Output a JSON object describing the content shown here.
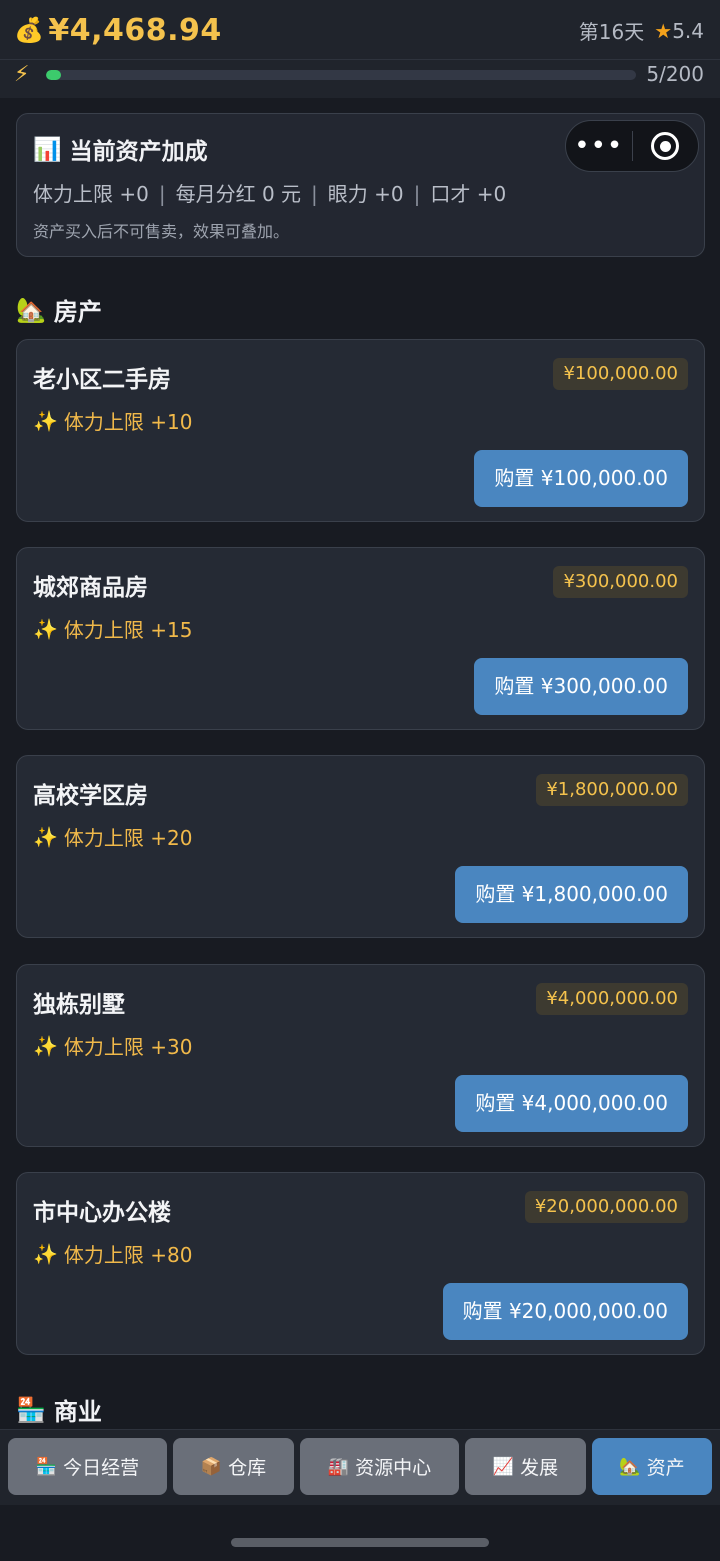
{
  "header": {
    "money_icon": "money-bag-icon",
    "money": "¥4,468.94",
    "day": "第16天",
    "star_icon": "star-icon",
    "rating": "5.4"
  },
  "energy": {
    "icon": "lightning-icon",
    "current": 5,
    "max": 200,
    "label": "5/200"
  },
  "bonus_panel": {
    "icon": "bar-chart-icon",
    "title": "当前资产加成",
    "stats": [
      "体力上限 +0",
      "每月分红 0 元",
      "眼力 +0",
      "口才 +0"
    ],
    "separator": "|",
    "note": "资产买入后不可售卖，效果可叠加。"
  },
  "capsule": {
    "more_label": "•••"
  },
  "property_section": {
    "icon": "house-icon",
    "title": "房产",
    "items": [
      {
        "name": "老小区二手房",
        "price": "¥100,000.00",
        "effect": "体力上限 +10",
        "buy_label": "购置 ¥100,000.00"
      },
      {
        "name": "城郊商品房",
        "price": "¥300,000.00",
        "effect": "体力上限 +15",
        "buy_label": "购置 ¥300,000.00"
      },
      {
        "name": "高校学区房",
        "price": "¥1,800,000.00",
        "effect": "体力上限 +20",
        "buy_label": "购置 ¥1,800,000.00"
      },
      {
        "name": "独栋别墅",
        "price": "¥4,000,000.00",
        "effect": "体力上限 +30",
        "buy_label": "购置 ¥4,000,000.00"
      },
      {
        "name": "市中心办公楼",
        "price": "¥20,000,000.00",
        "effect": "体力上限 +80",
        "buy_label": "购置 ¥20,000,000.00"
      }
    ]
  },
  "business_section": {
    "icon": "store-icon",
    "title": "商业"
  },
  "tabs": [
    {
      "label": "今日经营",
      "icon": "store-icon",
      "active": false
    },
    {
      "label": "仓库",
      "icon": "package-icon",
      "active": false
    },
    {
      "label": "资源中心",
      "icon": "factory-icon",
      "active": false
    },
    {
      "label": "发展",
      "icon": "trend-chart-icon",
      "active": false
    },
    {
      "label": "资产",
      "icon": "house-icon",
      "active": true
    }
  ],
  "colors": {
    "gold": "#f4c24d",
    "accent_blue": "#4a86c0",
    "energy_green": "#3ccb6c",
    "background": "#181b22"
  }
}
